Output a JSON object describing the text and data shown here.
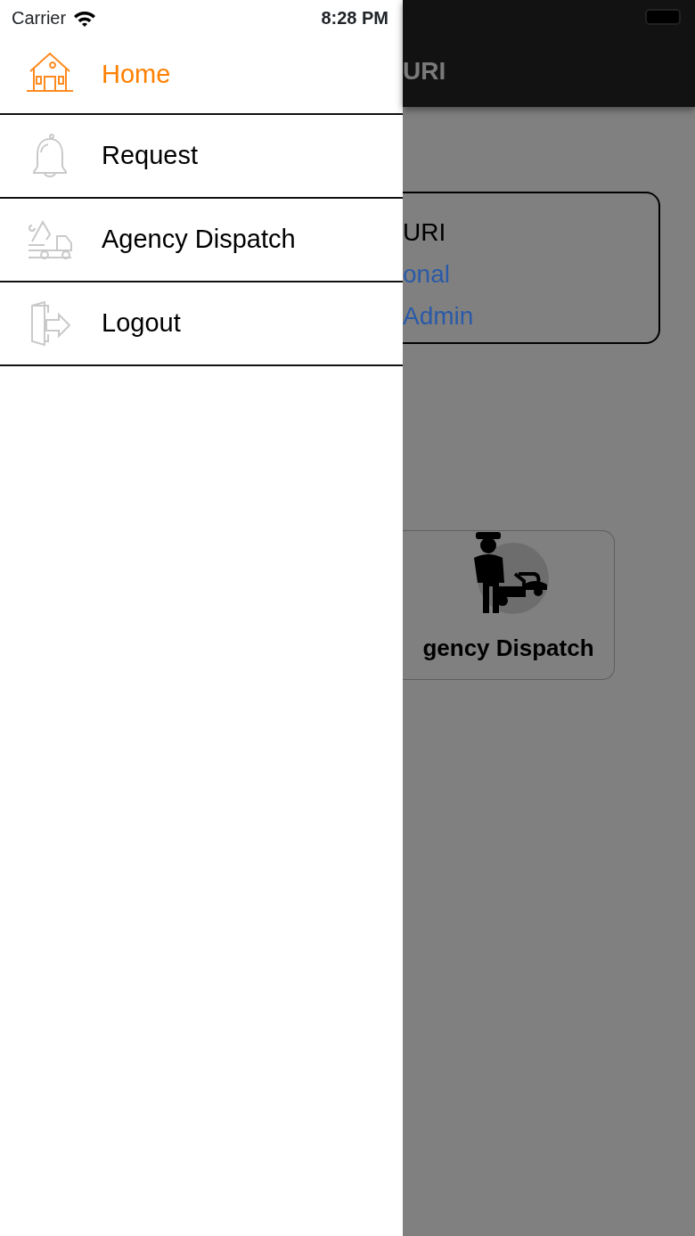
{
  "status_bar": {
    "carrier": "Carrier",
    "time": "8:28 PM"
  },
  "menu": [
    {
      "label": "Home",
      "kind": "home",
      "selected": true
    },
    {
      "label": "Request",
      "kind": "request",
      "selected": false
    },
    {
      "label": "Agency Dispatch",
      "kind": "dispatch",
      "selected": false
    },
    {
      "label": "Logout",
      "kind": "logout",
      "selected": false
    }
  ],
  "background": {
    "header_title": "URI",
    "profile_card": {
      "lines": [
        {
          "text": "URI",
          "kind": "name"
        },
        {
          "text": "onal",
          "kind": "link"
        },
        {
          "text": "Admin",
          "kind": "link"
        }
      ]
    },
    "tile": {
      "label": "gency Dispatch"
    }
  }
}
